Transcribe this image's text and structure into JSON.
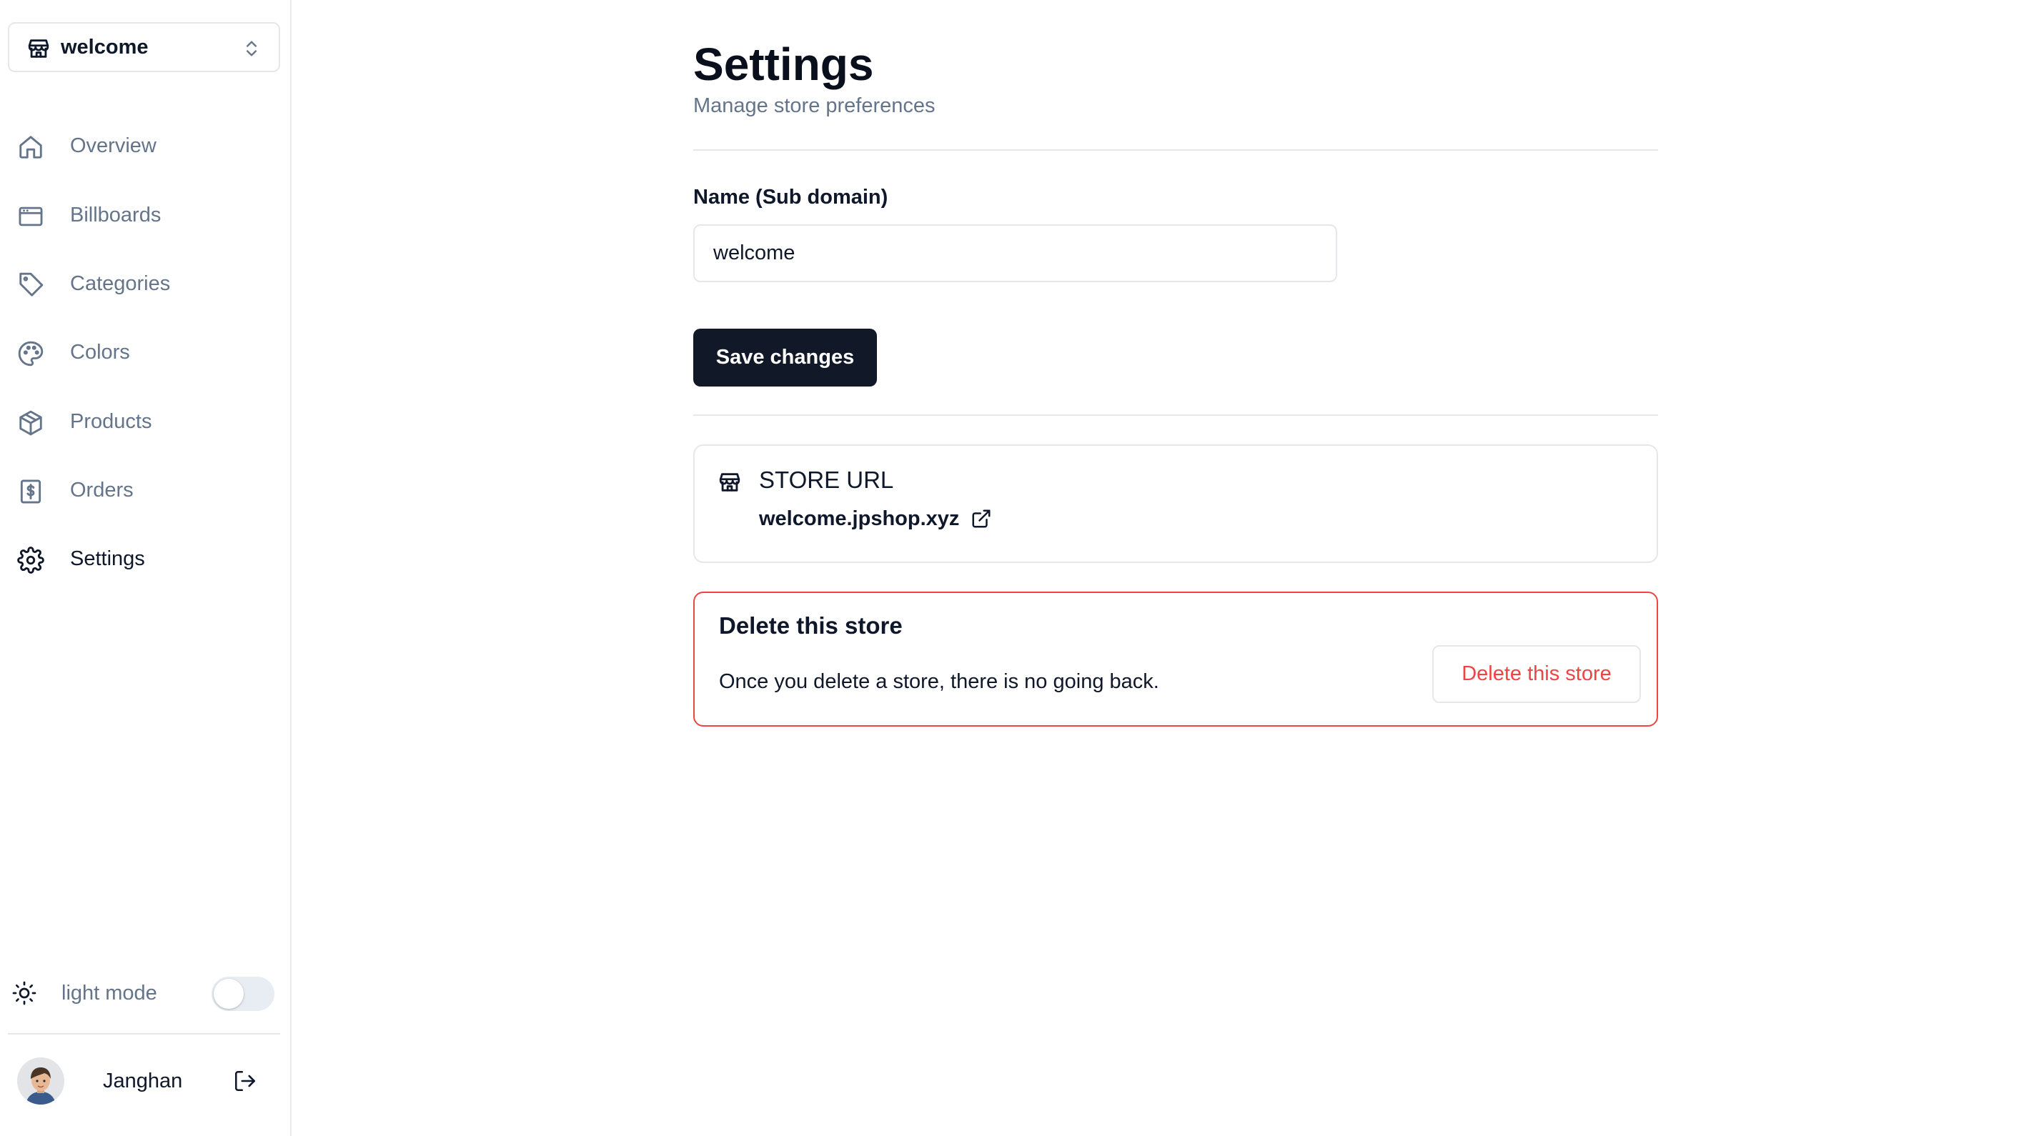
{
  "colors": {
    "primary": "#111827",
    "muted_text": "#64748b",
    "border": "#e5e7eb",
    "danger": "#ef4444"
  },
  "store_switcher": {
    "selected_store": "welcome",
    "icon": "store-icon",
    "chevron_icon": "chevrons-up-down-icon"
  },
  "sidebar": {
    "items": [
      {
        "label": "Overview",
        "icon": "home-icon",
        "active": false
      },
      {
        "label": "Billboards",
        "icon": "billboard-icon",
        "active": false
      },
      {
        "label": "Categories",
        "icon": "tag-icon",
        "active": false
      },
      {
        "label": "Colors",
        "icon": "palette-icon",
        "active": false
      },
      {
        "label": "Products",
        "icon": "package-icon",
        "active": false
      },
      {
        "label": "Orders",
        "icon": "receipt-icon",
        "active": false
      },
      {
        "label": "Settings",
        "icon": "gear-icon",
        "active": true
      }
    ],
    "theme_toggle": {
      "label": "light mode",
      "icon": "sun-icon",
      "on": false
    },
    "user": {
      "name": "Janghan",
      "logout_icon": "logout-icon"
    }
  },
  "main": {
    "title": "Settings",
    "subtitle": "Manage store preferences",
    "form": {
      "name_label": "Name (Sub domain)",
      "name_value": "welcome",
      "save_label": "Save changes"
    },
    "store_url_card": {
      "title": "STORE URL",
      "url": "welcome.jpshop.xyz",
      "icon": "store-icon",
      "link_icon": "external-link-icon"
    },
    "danger_zone": {
      "title": "Delete this store",
      "description": "Once you delete a store, there is no going back.",
      "button_label": "Delete this store"
    }
  }
}
